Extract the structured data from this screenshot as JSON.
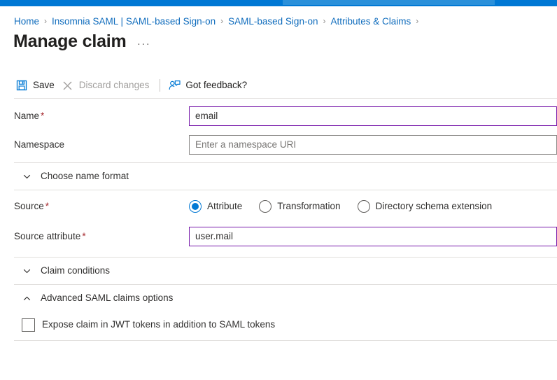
{
  "top_bar": {
    "accent_color": "#0078d4",
    "search_box_color": "#2a90da"
  },
  "breadcrumb": {
    "separator": "›",
    "items": [
      {
        "label": "Home"
      },
      {
        "label": "Insomnia SAML | SAML-based Sign-on"
      },
      {
        "label": "SAML-based Sign-on"
      },
      {
        "label": "Attributes & Claims"
      }
    ],
    "trailing_separator": "›"
  },
  "header": {
    "title": "Manage claim",
    "more_options": "···"
  },
  "command_bar": {
    "save_label": "Save",
    "save_icon": "save-floppy-icon",
    "discard_label": "Discard changes",
    "discard_icon": "close-x-icon",
    "feedback_label": "Got feedback?",
    "feedback_icon": "person-feedback-icon",
    "icon_color": "#0078d4",
    "disabled_color": "#a19f9d"
  },
  "form": {
    "name": {
      "label": "Name",
      "required_marker": "*",
      "value": "email",
      "placeholder": "",
      "border_color": "#7719aa"
    },
    "namespace": {
      "label": "Namespace",
      "value": "",
      "placeholder": "Enter a namespace URI",
      "border_color": "#8a8886"
    },
    "choose_name_format": {
      "title": "Choose name format",
      "expanded": false,
      "chevron": "chevron-down-icon"
    },
    "source": {
      "label": "Source",
      "required_marker": "*",
      "options": [
        {
          "label": "Attribute",
          "selected": true
        },
        {
          "label": "Transformation",
          "selected": false
        },
        {
          "label": "Directory schema extension",
          "selected": false
        }
      ],
      "accent_color": "#0078d4"
    },
    "source_attribute": {
      "label": "Source attribute",
      "required_marker": "*",
      "value": "user.mail",
      "border_color": "#7719aa"
    },
    "claim_conditions": {
      "title": "Claim conditions",
      "expanded": false,
      "chevron": "chevron-down-icon"
    },
    "advanced_saml": {
      "title": "Advanced SAML claims options",
      "expanded": true,
      "chevron": "chevron-up-icon"
    },
    "expose_claim": {
      "label": "Expose claim in JWT tokens in addition to SAML tokens",
      "checked": false
    }
  }
}
